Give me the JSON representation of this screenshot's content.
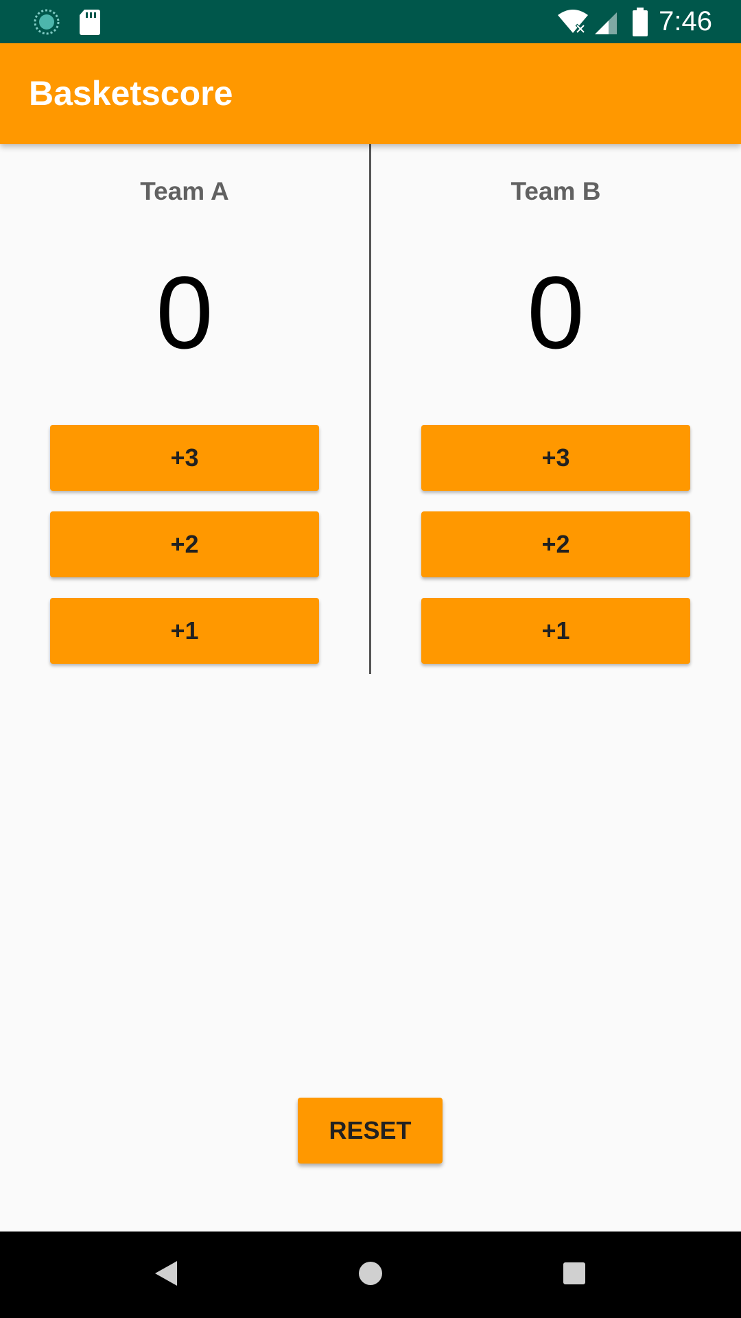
{
  "status_bar": {
    "time": "7:46",
    "background": "#00574b",
    "left_icons": [
      "sync-icon",
      "sd-card-icon"
    ],
    "right_icons": [
      "wifi-icon",
      "cell-signal-icon",
      "battery-icon"
    ]
  },
  "app_bar": {
    "title": "Basketscore",
    "color": "#ff9800"
  },
  "teams": [
    {
      "name": "Team A",
      "score": "0",
      "buttons": [
        "+3",
        "+2",
        "+1"
      ]
    },
    {
      "name": "Team B",
      "score": "0",
      "buttons": [
        "+3",
        "+2",
        "+1"
      ]
    }
  ],
  "reset_label": "RESET",
  "nav_bar": {
    "icons": [
      "back-icon",
      "home-icon",
      "recents-icon"
    ]
  }
}
